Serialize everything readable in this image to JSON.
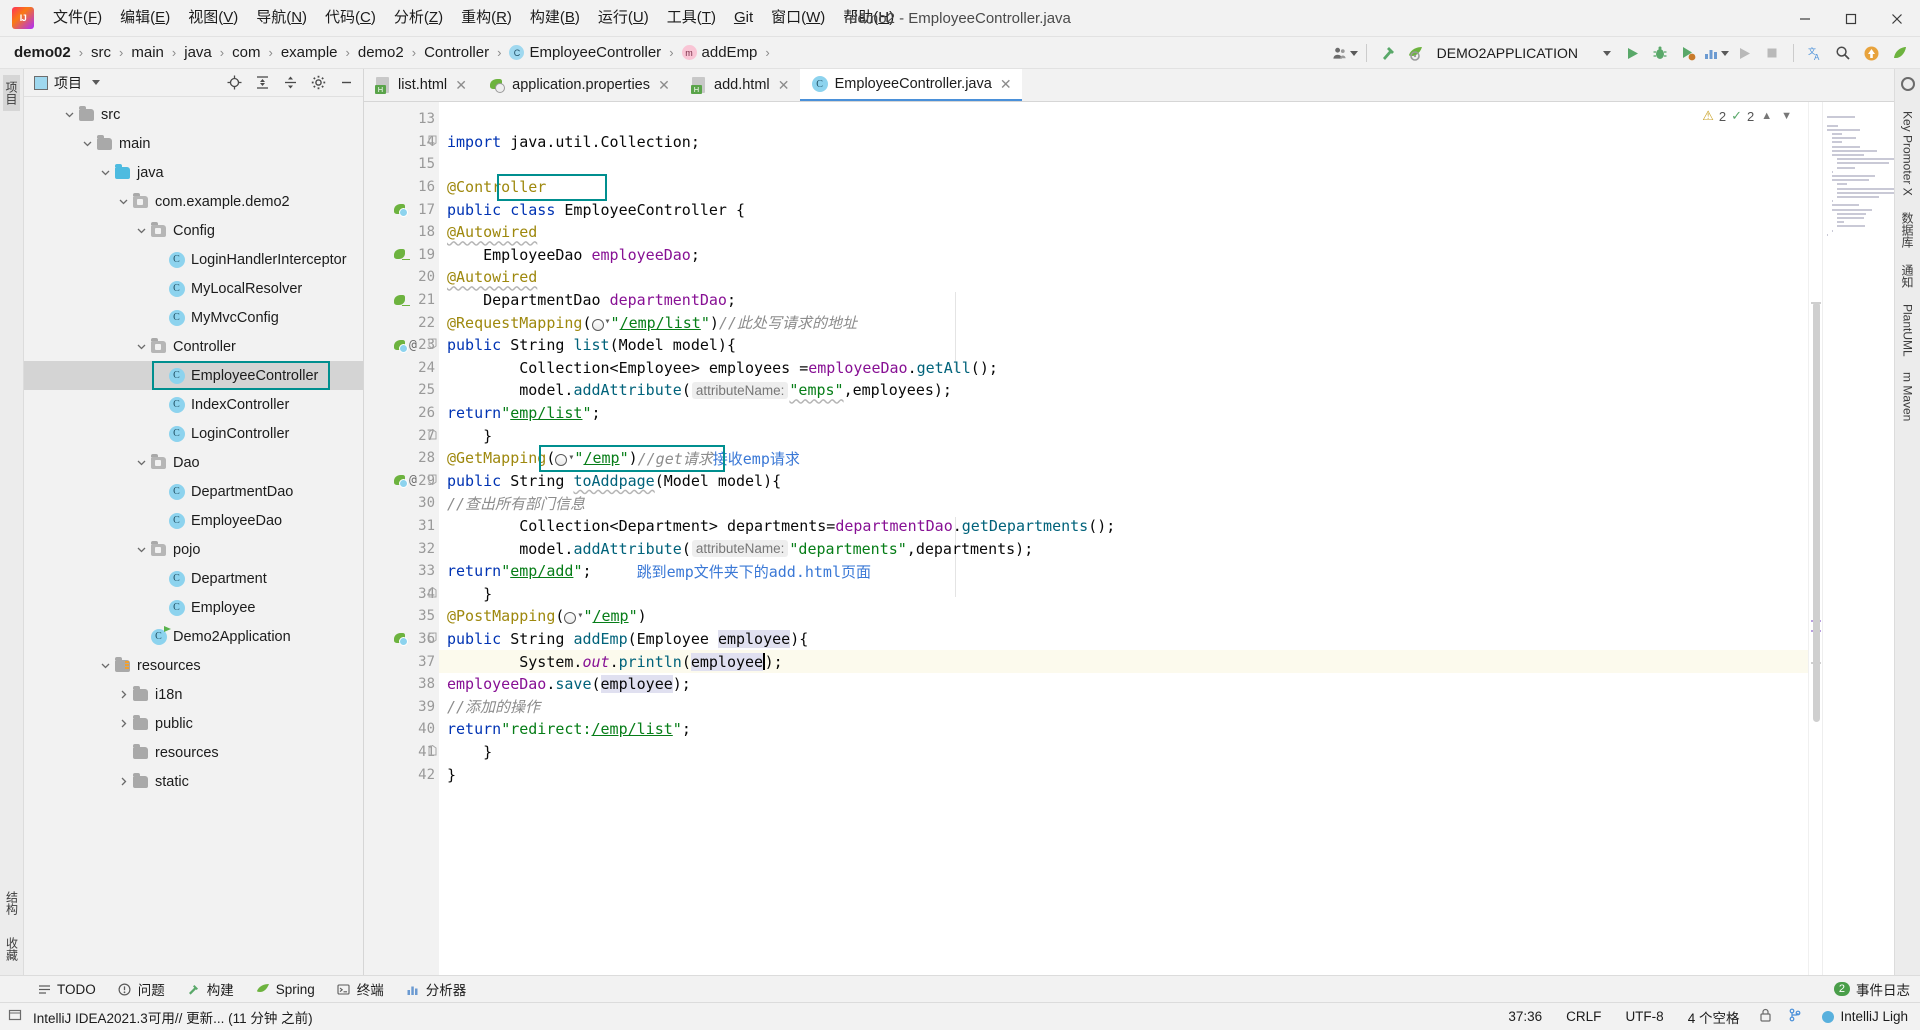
{
  "titlebar": {
    "logo_name": "intellij-idea-logo",
    "menus": [
      {
        "label": "文件(F)",
        "accel": "F"
      },
      {
        "label": "编辑(E)",
        "accel": "E"
      },
      {
        "label": "视图(V)",
        "accel": "V"
      },
      {
        "label": "导航(N)",
        "accel": "N"
      },
      {
        "label": "代码(C)",
        "accel": "C"
      },
      {
        "label": "分析(Z)",
        "accel": "Z"
      },
      {
        "label": "重构(R)",
        "accel": "R"
      },
      {
        "label": "构建(B)",
        "accel": "B"
      },
      {
        "label": "运行(U)",
        "accel": "U"
      },
      {
        "label": "工具(T)",
        "accel": "T"
      },
      {
        "label": "Git",
        "accel": "G"
      },
      {
        "label": "窗口(W)",
        "accel": "W"
      },
      {
        "label": "帮助(H)",
        "accel": "H"
      }
    ],
    "window_title": "demo2 - EmployeeController.java",
    "minimize": "minimize",
    "maximize": "maximize",
    "close": "close"
  },
  "navbar": {
    "crumbs": [
      {
        "label": "demo02",
        "icon": "none",
        "bold": true
      },
      {
        "label": "src",
        "icon": "none",
        "bold": false
      },
      {
        "label": "main",
        "icon": "none",
        "bold": false
      },
      {
        "label": "java",
        "icon": "none",
        "bold": false
      },
      {
        "label": "com",
        "icon": "none",
        "bold": false
      },
      {
        "label": "example",
        "icon": "none",
        "bold": false
      },
      {
        "label": "demo2",
        "icon": "none",
        "bold": false
      },
      {
        "label": "Controller",
        "icon": "none",
        "bold": false
      },
      {
        "label": "EmployeeController",
        "icon": "class",
        "bold": false
      },
      {
        "label": "addEmp",
        "icon": "method",
        "bold": false
      }
    ],
    "run_config": "DEMO2APPLICATION",
    "icons": [
      "user-icon",
      "build-hammer-icon",
      "spring-boot-icon",
      "run-icon",
      "debug-icon",
      "run-coverage-icon",
      "profile-icon",
      "attach-icon",
      "stop-icon",
      "translate-icon",
      "search-icon",
      "update-icon",
      "ide-eval-icon"
    ]
  },
  "project_panel": {
    "title": "项目",
    "header_icons": [
      "locate-icon",
      "expand-all-icon",
      "collapse-all-icon",
      "settings-gear-icon",
      "hide-icon"
    ],
    "tree": [
      {
        "label": "src",
        "depth": 1,
        "arrow": "down",
        "icon": "folder-src",
        "selected": false
      },
      {
        "label": "main",
        "depth": 2,
        "arrow": "down",
        "icon": "folder",
        "selected": false
      },
      {
        "label": "java",
        "depth": 3,
        "arrow": "down",
        "icon": "folder-source",
        "selected": false
      },
      {
        "label": "com.example.demo2",
        "depth": 4,
        "arrow": "down",
        "icon": "package",
        "selected": false
      },
      {
        "label": "Config",
        "depth": 5,
        "arrow": "down",
        "icon": "package",
        "selected": false
      },
      {
        "label": "LoginHandlerInterceptor",
        "depth": 6,
        "arrow": "none",
        "icon": "class",
        "selected": false
      },
      {
        "label": "MyLocalResolver",
        "depth": 6,
        "arrow": "none",
        "icon": "class",
        "selected": false
      },
      {
        "label": "MyMvcConfig",
        "depth": 6,
        "arrow": "none",
        "icon": "class",
        "selected": false
      },
      {
        "label": "Controller",
        "depth": 5,
        "arrow": "down",
        "icon": "package",
        "selected": false
      },
      {
        "label": "EmployeeController",
        "depth": 6,
        "arrow": "none",
        "icon": "class",
        "selected": true
      },
      {
        "label": "IndexController",
        "depth": 6,
        "arrow": "none",
        "icon": "class",
        "selected": false
      },
      {
        "label": "LoginController",
        "depth": 6,
        "arrow": "none",
        "icon": "class",
        "selected": false
      },
      {
        "label": "Dao",
        "depth": 5,
        "arrow": "down",
        "icon": "package",
        "selected": false
      },
      {
        "label": "DepartmentDao",
        "depth": 6,
        "arrow": "none",
        "icon": "class",
        "selected": false
      },
      {
        "label": "EmployeeDao",
        "depth": 6,
        "arrow": "none",
        "icon": "class",
        "selected": false
      },
      {
        "label": "pojo",
        "depth": 5,
        "arrow": "down",
        "icon": "package",
        "selected": false
      },
      {
        "label": "Department",
        "depth": 6,
        "arrow": "none",
        "icon": "class",
        "selected": false
      },
      {
        "label": "Employee",
        "depth": 6,
        "arrow": "none",
        "icon": "class",
        "selected": false
      },
      {
        "label": "Demo2Application",
        "depth": 5,
        "arrow": "none",
        "icon": "class-spring",
        "selected": false
      },
      {
        "label": "resources",
        "depth": 3,
        "arrow": "down",
        "icon": "folder-resources",
        "selected": false
      },
      {
        "label": "i18n",
        "depth": 4,
        "arrow": "right",
        "icon": "folder",
        "selected": false
      },
      {
        "label": "public",
        "depth": 4,
        "arrow": "right",
        "icon": "folder",
        "selected": false
      },
      {
        "label": "resources",
        "depth": 4,
        "arrow": "none",
        "icon": "folder",
        "selected": false
      },
      {
        "label": "static",
        "depth": 4,
        "arrow": "right",
        "icon": "folder",
        "selected": false
      }
    ]
  },
  "left_strip": {
    "labels": [
      "项目",
      "收藏"
    ]
  },
  "right_strip": {
    "labels": [
      "Key Promoter X",
      "数据库",
      "通知",
      "PlantUML",
      "m Maven"
    ]
  },
  "editor": {
    "tabs": [
      {
        "label": "list.html",
        "icon": "html-file-icon",
        "active": false
      },
      {
        "label": "application.properties",
        "icon": "spring-properties-icon",
        "active": false
      },
      {
        "label": "add.html",
        "icon": "html-file-icon",
        "active": false
      },
      {
        "label": "EmployeeController.java",
        "icon": "java-class-icon",
        "active": true
      }
    ],
    "inspections": {
      "warnings": "2",
      "checks": "2"
    },
    "first_line": 13,
    "lines": [
      {
        "n": 13,
        "gutter": [],
        "fold": "",
        "html": ""
      },
      {
        "n": 14,
        "gutter": [],
        "fold": "fold-start",
        "html": "<span class=\"kw\">import</span> java.util.Collection;"
      },
      {
        "n": 15,
        "gutter": [],
        "fold": "",
        "html": ""
      },
      {
        "n": 16,
        "gutter": [],
        "fold": "",
        "html": "<span class=\"anno\">@Controller</span>"
      },
      {
        "n": 17,
        "gutter": [
          "spring-bean"
        ],
        "fold": "",
        "html": "<span class=\"kw\">public class</span> EmployeeController {"
      },
      {
        "n": 18,
        "gutter": [],
        "fold": "",
        "html": "    <span class=\"anno wavy\">@Autowired</span>"
      },
      {
        "n": 19,
        "gutter": [
          "spring-autowire"
        ],
        "fold": "",
        "html": "    EmployeeDao <span class=\"fld\">employeeDao</span>;"
      },
      {
        "n": 20,
        "gutter": [],
        "fold": "",
        "html": "    <span class=\"anno wavy\">@Autowired</span>"
      },
      {
        "n": 21,
        "gutter": [
          "spring-autowire"
        ],
        "fold": "",
        "html": "    DepartmentDao <span class=\"fld\">departmentDao</span>;"
      },
      {
        "n": 22,
        "gutter": [],
        "fold": "",
        "html": "    <span class=\"anno\">@RequestMapping</span>(<span class=\"globe\"><i></i><b>&#9662;</b></span><span class=\"str\">\"</span><span class=\"str-link\">/emp/list</span><span class=\"str\">\"</span>)<span class=\"cm\">//此处写请求的地址</span>"
      },
      {
        "n": 23,
        "gutter": [
          "spring-bean",
          "at"
        ],
        "fold": "fold-start",
        "html": "    <span class=\"kw\">public</span> String <span class=\"mth\">list</span>(Model model){"
      },
      {
        "n": 24,
        "gutter": [],
        "fold": "",
        "html": "        Collection&lt;Employee&gt; employees =<span class=\"fld\">employeeDao</span>.<span class=\"mth\">getAll</span>();"
      },
      {
        "n": 25,
        "gutter": [],
        "fold": "",
        "html": "        model.<span class=\"mth\">addAttribute</span>(<span class=\"hint\">attributeName:</span> <span class=\"str wavy\">\"emps\"</span>,employees);"
      },
      {
        "n": 26,
        "gutter": [],
        "fold": "",
        "html": "        <span class=\"kw\">return</span> <span class=\"str\">\"</span><span class=\"str-link\">emp/list</span><span class=\"str\">\"</span>;"
      },
      {
        "n": 27,
        "gutter": [],
        "fold": "fold-end",
        "html": "    }"
      },
      {
        "n": 28,
        "gutter": [],
        "fold": "",
        "html": "    <span class=\"anno\">@GetMapping</span>(<span class=\"globe\"><i></i><b>&#9662;</b></span><span class=\"str\">\"</span><span class=\"str-link\">/emp</span><span class=\"str\">\"</span>)<span class=\"cm\">//get请求</span>   <span class=\"note\">接收emp请求</span>"
      },
      {
        "n": 29,
        "gutter": [
          "spring-bean",
          "at"
        ],
        "fold": "fold-start",
        "html": "    <span class=\"kw\">public</span> String <span class=\"mth wavy\">toAddpage</span>(Model model){"
      },
      {
        "n": 30,
        "gutter": [],
        "fold": "",
        "html": "        <span class=\"cm\">//查出所有部门信息</span>"
      },
      {
        "n": 31,
        "gutter": [],
        "fold": "",
        "html": "        Collection&lt;Department&gt; departments=<span class=\"fld\">departmentDao</span>.<span class=\"mth\">getDepartments</span>();"
      },
      {
        "n": 32,
        "gutter": [],
        "fold": "",
        "html": "        model.<span class=\"mth\">addAttribute</span>(<span class=\"hint\">attributeName:</span> <span class=\"str\">\"departments\"</span>,departments);"
      },
      {
        "n": 33,
        "gutter": [],
        "fold": "",
        "html": "        <span class=\"kw\">return</span> <span class=\"str\">\"</span><span class=\"str-link\">emp/add</span><span class=\"str\">\"</span>;     <span class=\"note\">跳到emp文件夹下的add.html页面</span>"
      },
      {
        "n": 34,
        "gutter": [],
        "fold": "fold-end",
        "html": "    }"
      },
      {
        "n": 35,
        "gutter": [],
        "fold": "",
        "html": "    <span class=\"anno\">@PostMapping</span>(<span class=\"globe\"><i></i><b>&#9662;</b></span><span class=\"str\">\"</span><span class=\"str-link\">/emp</span><span class=\"str\">\"</span>)"
      },
      {
        "n": 36,
        "gutter": [
          "spring-bean"
        ],
        "fold": "fold-start",
        "html": "    <span class=\"kw\">public</span> String <span class=\"mth\">addEmp</span>(Employee <span class=\"sel-hl\">employee</span>){"
      },
      {
        "n": 37,
        "gutter": [],
        "fold": "",
        "hl": true,
        "html": "        System.<span class=\"fld\" style=\"font-style:italic\">out</span>.<span class=\"mth\">println</span>(<span class=\"sel-hl\">employee</span><span class=\"cursor\"></span>);"
      },
      {
        "n": 38,
        "gutter": [],
        "fold": "",
        "html": "        <span class=\"fld\">employeeDao</span>.<span class=\"mth\">save</span>(<span class=\"sel-hl\">employee</span>);"
      },
      {
        "n": 39,
        "gutter": [],
        "fold": "",
        "html": "        <span class=\"cm\">//添加的操作</span>"
      },
      {
        "n": 40,
        "gutter": [],
        "fold": "",
        "html": "        <span class=\"kw\">return</span> <span class=\"str\">\"redirect:</span><span class=\"str-link\">/emp/list</span><span class=\"str\">\"</span>;"
      },
      {
        "n": 41,
        "gutter": [],
        "fold": "fold-end",
        "html": "    }"
      },
      {
        "n": 42,
        "gutter": [],
        "fold": "",
        "html": "}"
      }
    ]
  },
  "bottom_toolbar": {
    "windows": [
      {
        "label": "TODO",
        "icon": "todo-icon"
      },
      {
        "label": "问题",
        "icon": "problems-icon"
      },
      {
        "label": "构建",
        "icon": "build-icon"
      },
      {
        "label": "Spring",
        "icon": "spring-icon"
      },
      {
        "label": "终端",
        "icon": "terminal-icon"
      },
      {
        "label": "分析器",
        "icon": "profiler-icon"
      }
    ],
    "right_label": "事件日志",
    "right_count": "2",
    "right_icon": "event-log-icon"
  },
  "status_bar": {
    "message": "IntelliJ IDEA2021.3可用// 更新... (11 分钟 之前)",
    "caret": "37:36",
    "line_sep": "CRLF",
    "encoding": "UTF-8",
    "indent": "4 个空格",
    "theme": "IntelliJ Ligh",
    "icons": [
      "notification-icon",
      "git-branch-icon",
      "lock-icon",
      "bulb-icon"
    ]
  },
  "colors": {
    "accent_teal": "#008f8f",
    "keyword_blue": "#0033b3",
    "string_green": "#067d17",
    "annotation_gold": "#9e880d",
    "field_purple": "#871094",
    "method_teal": "#00627a",
    "note_blue": "#3a78d6",
    "tab_active_underline": "#4a90d9",
    "selection_gray": "#d4d4d4"
  }
}
